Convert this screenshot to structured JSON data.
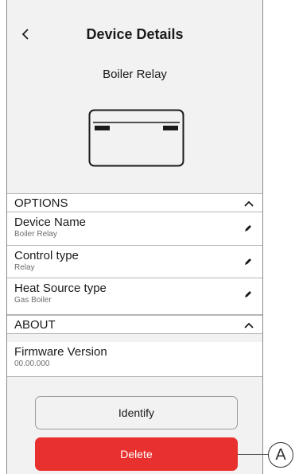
{
  "header": {
    "back_icon": "‹",
    "title": "Device Details",
    "device_name": "Boiler Relay"
  },
  "options": {
    "label": "OPTIONS",
    "rows": [
      {
        "label": "Device Name",
        "value": "Boiler Relay"
      },
      {
        "label": "Control type",
        "value": "Relay"
      },
      {
        "label": "Heat Source type",
        "value": "Gas Boiler"
      }
    ]
  },
  "about": {
    "label": "ABOUT",
    "rows": [
      {
        "label": "Firmware Version",
        "value": "00.00.000"
      }
    ]
  },
  "buttons": {
    "identify": "Identify",
    "delete": "Delete"
  },
  "callout": {
    "letter": "A"
  },
  "colors": {
    "delete_red": "#e8302f",
    "background": "#f2f2f2"
  },
  "icons": [
    "back-chevron-icon",
    "chevron-up-icon",
    "pencil-edit-icon",
    "relay-device-icon"
  ]
}
